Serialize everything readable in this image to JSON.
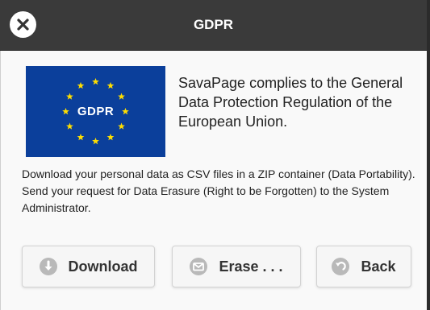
{
  "dialog": {
    "title": "GDPR",
    "logo_text": "GDPR",
    "intro": "SavaPage complies to the General Data Protection Regulation of the European Union.",
    "details": "Download your personal data as CSV files in a ZIP container (Data Portability). Send your request for Data Erasure (Right to be Forgotten) to the System Administrator.",
    "buttons": {
      "download": "Download",
      "erase": "Erase . . .",
      "back": "Back"
    }
  },
  "icons": {
    "close": "close-icon",
    "download": "arrow-down-icon",
    "erase": "mail-icon",
    "back": "back-arrow-icon"
  },
  "colors": {
    "titlebar": "#3a3a3a",
    "eu_blue": "#0b3f9b",
    "eu_star": "#ffde00",
    "button_icon": "#b9b9b9"
  }
}
